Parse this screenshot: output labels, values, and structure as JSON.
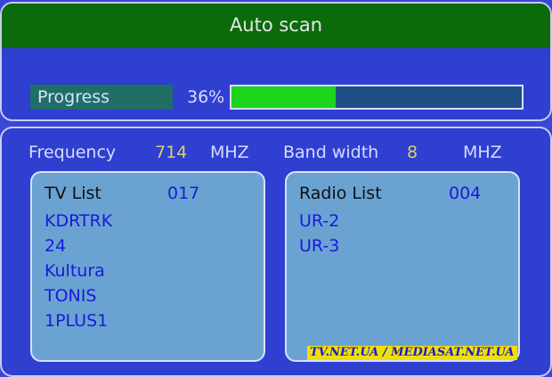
{
  "window": {
    "title": "Auto scan"
  },
  "progress": {
    "label": "Progress",
    "percent_text": "36%",
    "value": 0.36
  },
  "frequency": {
    "label": "Frequency",
    "value": "714",
    "unit": "MHZ"
  },
  "bandwidth": {
    "label": "Band width",
    "value": "8",
    "unit": "MHZ"
  },
  "tv_list": {
    "title": "TV List",
    "count": "017",
    "items": [
      "KDRTRK",
      "24",
      "Kultura",
      "TONIS",
      "1PLUS1"
    ]
  },
  "radio_list": {
    "title": "Radio List",
    "count": "004",
    "items": [
      "UR-2",
      "UR-3"
    ]
  },
  "watermark": "TV.NET.UA / MEDIASAT.NET.UA",
  "colors": {
    "title_bar": "#0b6b0b",
    "progress_fill": "#1cd41c",
    "panel": "#2f3fd0",
    "list_box": "#6aa3d2"
  }
}
